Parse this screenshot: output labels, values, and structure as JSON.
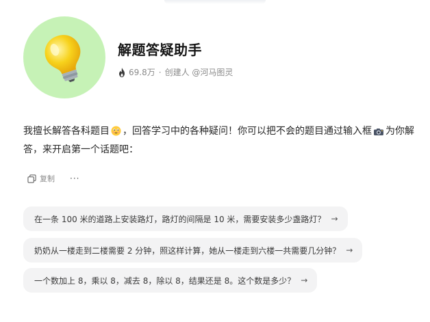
{
  "bot": {
    "name": "解题答疑助手",
    "stats": {
      "popularity": "69.8万",
      "separator": "·",
      "creator": "创建人 @河马图灵"
    },
    "intro_part1": "我擅长解答各科题目",
    "intro_part2": "，回答学习中的各种疑问！你可以把不会的题目通过输入框",
    "intro_part3": "为你解答，来开启第一个话题吧："
  },
  "actions": {
    "copy_label": "复制",
    "more_label": "···"
  },
  "suggestions": [
    "在一条 100 米的道路上安装路灯，路灯的间隔是 10 米，需要安装多少盏路灯？",
    "奶奶从一楼走到二楼需要 2 分钟，照这样计算，她从一楼走到六楼一共需要几分钟？",
    "一个数加上 8，乘以 8，减去 8，除以 8，结果还是 8。这个数是多少？"
  ],
  "suggestion_arrow": "→",
  "colors": {
    "avatar_bg": "#c6f2b6",
    "bulb_yellow": "#f7d21c",
    "chip_bg": "#f3f3f4"
  },
  "icons": [
    "lightbulb-icon",
    "fire-icon",
    "smile-emoji-icon",
    "camera-emoji-icon",
    "copy-icon",
    "more-icon",
    "arrow-right-icon"
  ]
}
